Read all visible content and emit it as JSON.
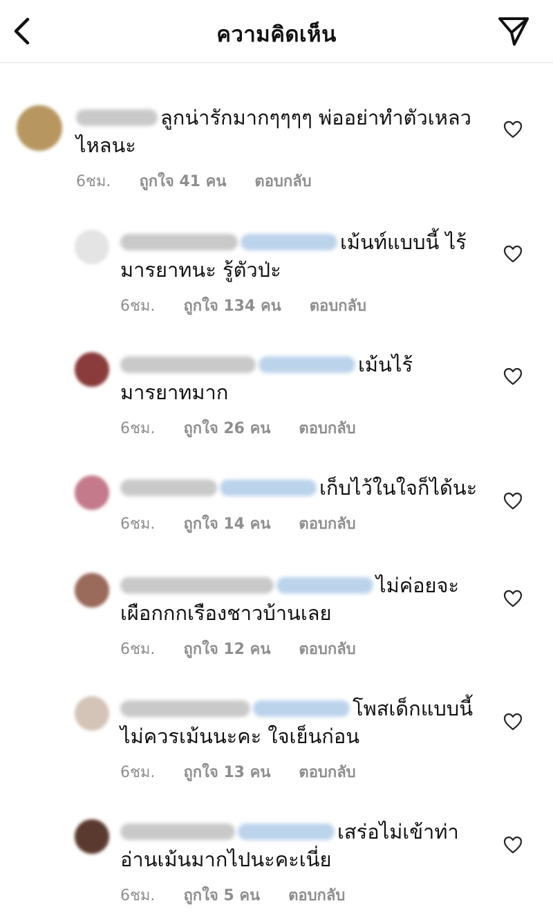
{
  "header": {
    "title": "ความคิดเห็น",
    "back_icon": "chevron-left-icon",
    "send_icon": "paper-plane-icon"
  },
  "colors": {
    "meta_text": "#8e8e8e",
    "name_blur": "#c9c9c9",
    "mention_blur": "#bcd3ec",
    "divider": "#e3e3e3"
  },
  "comments": [
    {
      "kind": "main",
      "avatar_color": "#b89660",
      "mention": false,
      "text_line1": "ลูกน่ารักมากๆๆๆๆ พ่ออย่าทำตัวเหลว",
      "text_line2": "ไหลนะ",
      "time": "6ชม.",
      "likes": "ถูกใจ 41 คน",
      "reply": "ตอบกลับ"
    },
    {
      "kind": "reply",
      "avatar_color": "#e4e4e4",
      "mention": true,
      "text_line1": "เม้นท์แบบนี้ ไร้",
      "text_line2": "มารยาทนะ รู้ตัวป่ะ",
      "time": "6ชม.",
      "likes": "ถูกใจ 134 คน",
      "reply": "ตอบกลับ"
    },
    {
      "kind": "reply",
      "avatar_color": "#8a3b3b",
      "mention": true,
      "text_line1": "เม้นไร้",
      "text_line2": "มารยาทมาก",
      "time": "6ชม.",
      "likes": "ถูกใจ 26 คน",
      "reply": "ตอบกลับ"
    },
    {
      "kind": "reply",
      "avatar_color": "#c47a8a",
      "mention": true,
      "text_line1": "เก็บไว้ในใจก็ได้นะ",
      "text_line2": "",
      "time": "6ชม.",
      "likes": "ถูกใจ 14 คน",
      "reply": "ตอบกลับ"
    },
    {
      "kind": "reply",
      "avatar_color": "#9a6a5a",
      "mention": true,
      "text_line1": "ไม่ค่อยจะ",
      "text_line2": "เผือกกกเรืองชาวบ้านเลย",
      "time": "6ชม.",
      "likes": "ถูกใจ 12 คน",
      "reply": "ตอบกลับ"
    },
    {
      "kind": "reply",
      "avatar_color": "#d4c4b8",
      "mention": true,
      "text_line1": "โพสเด็กแบบนี้",
      "text_line2": "ไม่ควรเม้นนะคะ ใจเย็นก่อน",
      "time": "6ชม.",
      "likes": "ถูกใจ 13 คน",
      "reply": "ตอบกลับ"
    },
    {
      "kind": "reply",
      "avatar_color": "#5a3a2e",
      "mention": true,
      "text_line1": "เสร่อไม่เข้าท่า",
      "text_line2": "อ่านเม้นมากไปนะคะเนี่ย",
      "time": "6ชม.",
      "likes": "ถูกใจ 5 คน",
      "reply": "ตอบกลับ"
    }
  ],
  "heart_icon": "heart-outline-icon"
}
